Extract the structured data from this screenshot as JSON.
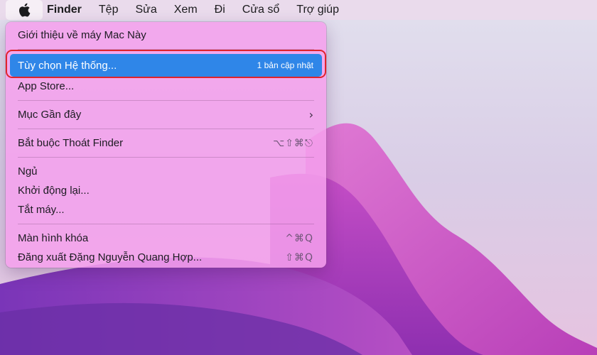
{
  "menubar": {
    "apple_icon": "apple-logo-icon",
    "items": [
      "Finder",
      "Tệp",
      "Sửa",
      "Xem",
      "Đi",
      "Cửa sổ",
      "Trợ giúp"
    ]
  },
  "apple_menu": {
    "about": "Giới thiệu về máy Mac Này",
    "system_prefs": "Tùy chọn Hệ thống...",
    "system_prefs_badge": "1 bản cập nhật",
    "app_store": "App Store...",
    "recent_items": "Mục Gần đây",
    "recent_items_chevron": "›",
    "force_quit": "Bắt buộc Thoát Finder",
    "force_quit_shortcut": "⌥⇧⌘⎋",
    "sleep": "Ngủ",
    "restart": "Khởi động lại...",
    "shutdown": "Tắt máy...",
    "lock_screen": "Màn hình khóa",
    "lock_screen_shortcut": "^⌘Q",
    "logout": "Đăng xuất Đặng Nguyễn Quang Hợp...",
    "logout_shortcut": "⇧⌘Q"
  },
  "colors": {
    "selection": "#2f86e8",
    "highlight_ring": "#e0242b",
    "menu_background": "#f4a0ec"
  }
}
